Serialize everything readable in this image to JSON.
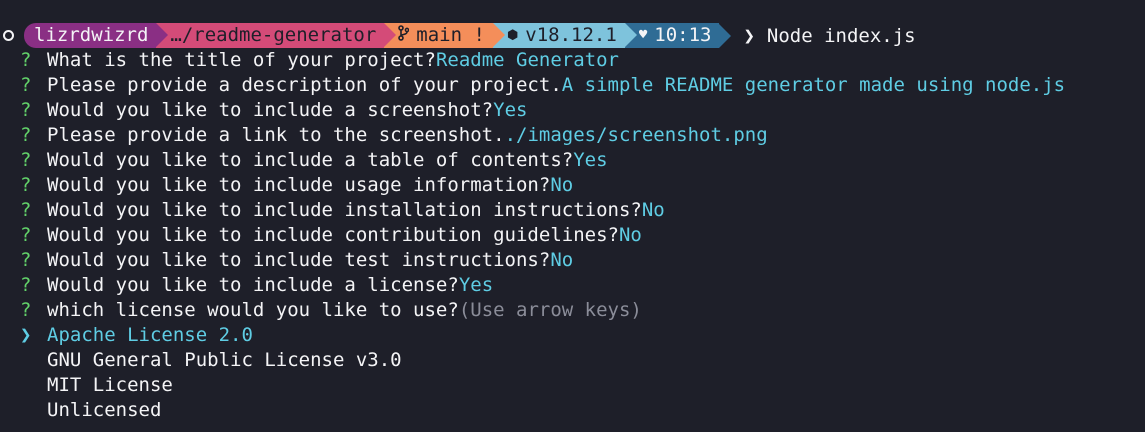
{
  "prompt": {
    "user": "lizrdwizrd",
    "path": "…/readme-generator",
    "branch": "main !",
    "node_version": "v18.12.1",
    "time": "10:13",
    "command": "Node index.js",
    "colors": {
      "user": "#8a2f84",
      "path": "#d44b78",
      "git": "#f48e5a",
      "node": "#7ec3dc",
      "time": "#2f6c95"
    },
    "icons": [
      "ring-icon",
      "branch-icon",
      "node-icon",
      "heart-icon",
      "chevron-right-icon"
    ]
  },
  "questions": [
    {
      "mark": "?",
      "text": "What is the title of your project?",
      "answer": "Readme Generator"
    },
    {
      "mark": "?",
      "text": "Please provide a description of your project.",
      "answer": "A simple README generator made using node.js"
    },
    {
      "mark": "?",
      "text": "Would you like to include a screenshot?",
      "answer": "Yes"
    },
    {
      "mark": "?",
      "text": "Please provide a link to the screenshot.",
      "answer": "./images/screenshot.png"
    },
    {
      "mark": "?",
      "text": "Would you like to include a table of contents?",
      "answer": "Yes"
    },
    {
      "mark": "?",
      "text": "Would you like to include usage information?",
      "answer": "No"
    },
    {
      "mark": "?",
      "text": "Would you like to include installation instructions?",
      "answer": "No"
    },
    {
      "mark": "?",
      "text": "Would you like to include contribution guidelines?",
      "answer": "No"
    },
    {
      "mark": "?",
      "text": "Would you like to include test instructions?",
      "answer": "No"
    },
    {
      "mark": "?",
      "text": "Would you like to include a license?",
      "answer": "Yes"
    }
  ],
  "license_question": {
    "mark": "?",
    "text": "which license would you like to use?",
    "hint": "(Use arrow keys)"
  },
  "license_options": {
    "pointer": "❯",
    "selected": "Apache License 2.0",
    "others": [
      "GNU General Public License v3.0",
      "MIT License",
      "Unlicensed"
    ]
  },
  "theme": {
    "background": "#1e1f29",
    "question_mark": "#63d36a",
    "answer": "#5fcde4",
    "hint": "#8b8d99"
  }
}
